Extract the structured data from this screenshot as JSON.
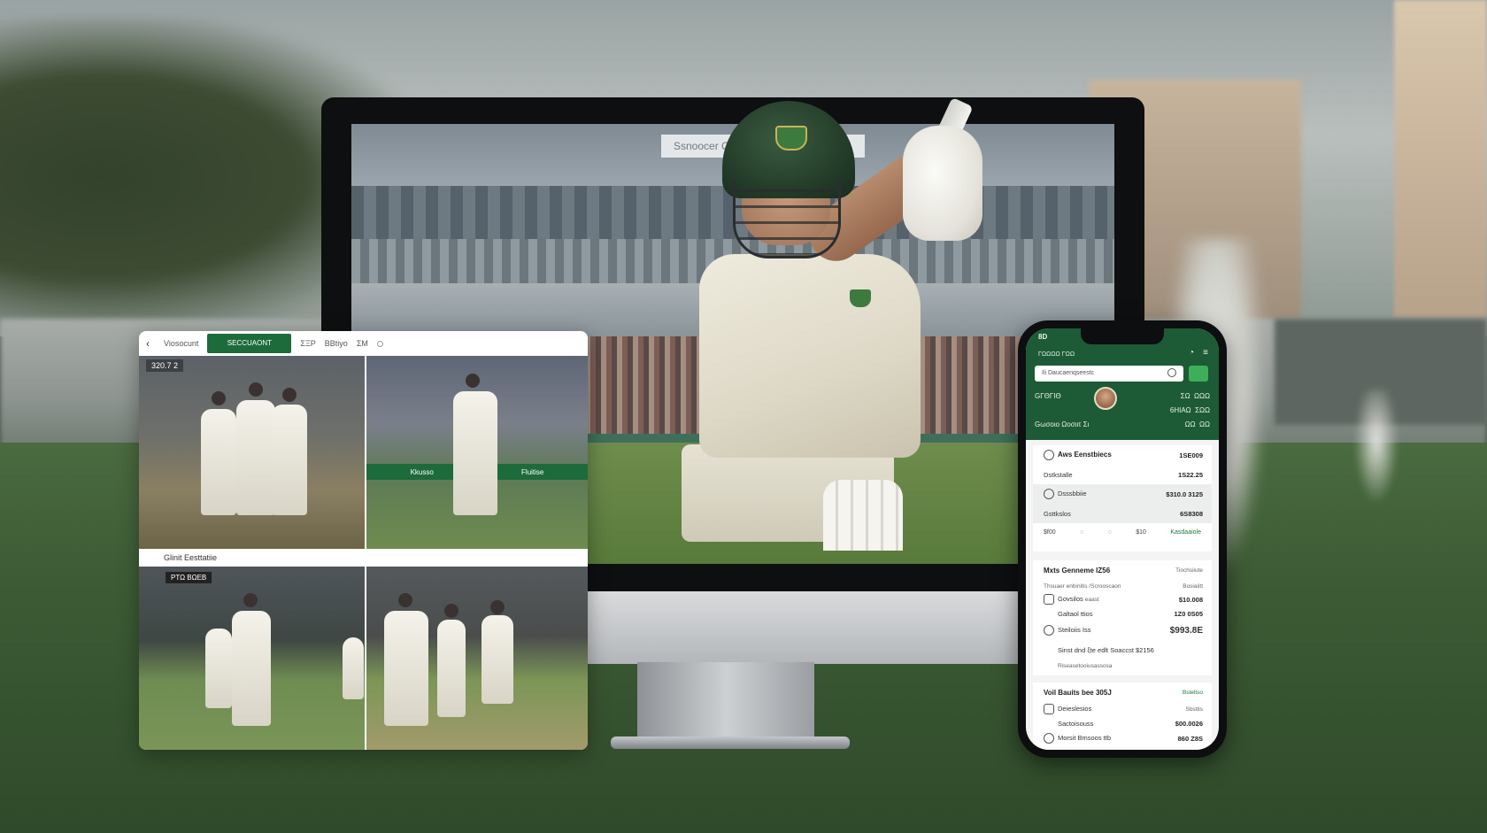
{
  "tablet": {
    "back_icon": "‹",
    "nav_label": "Viosocunt",
    "active_tab": "SECCUAONT",
    "links": [
      "ΣΞΡ",
      "BBtiyo",
      "ΣΜ"
    ],
    "tile_score": "320.7 2",
    "hoarding_left": "Kkusso",
    "hoarding_right": "Fluitise",
    "caption": "Glinit  Eesttatiie",
    "scoreboard": "ΡΤΩ ΒΩΕΒ"
  },
  "monitor": {
    "stadium_banner": "Ssnoocer Canmsty"
  },
  "phone": {
    "status_time": "8D",
    "brand": "ΓΩΩΩΩ ΓΩΩ",
    "search_placeholder": "Ili Daucaenqseestc",
    "score_rows": [
      {
        "left": "GΓΘΓΙΘ",
        "right_a": "ΣΩ",
        "right_b": "ΩΩΩ"
      },
      {
        "left": "",
        "right_a": "6ΗΙΑΩ",
        "right_b": "ΣΩΩ"
      },
      {
        "left": "Gωσοιο  Ωοσιιτ  Σι",
        "right_a": "ΩΩ",
        "right_b": "ΩΩ"
      }
    ],
    "card1": [
      {
        "label": "Aws Eenstbiecs",
        "value": "1SE009"
      },
      {
        "label": "Dstkstalle",
        "value": "1S22.25"
      },
      {
        "label": "Dsssbbiie",
        "value": "$310.0 3125"
      },
      {
        "label": "Gsttkslos",
        "value": "6S8308"
      }
    ],
    "card1_footer": [
      "$f00",
      "◌",
      "◌",
      "$10",
      "Kasdaaiole"
    ],
    "card2_title": "Mxts Genneme IZ56",
    "card2_title_right": "Tiochsiiute",
    "card2_sub": "Thsuaer enbinitis /Scrooscaon",
    "card2_sub_right": "Bosiaiitt",
    "card2_lines": [
      {
        "label": "Govsilos",
        "mid": "eaast",
        "value": "$10.008"
      },
      {
        "label": "Galtaol ttios",
        "mid": "",
        "value": "1Z0 0S05"
      },
      {
        "label": "Steiloiis Iss",
        "mid": "",
        "value": "$993.8E"
      },
      {
        "label": "Sinst dnd ξte edlt Soaccst $2156",
        "mid": "",
        "value": ""
      },
      {
        "label": "Riseasetooiusassosa",
        "mid": "",
        "value": ""
      }
    ],
    "card3_title": "Voil Bauits bee 305J",
    "card3_title_right": "Bsteltso",
    "card3_lines": [
      {
        "label": "Deieslesios",
        "value": "Sbsttis"
      },
      {
        "label": "Sactoisouss",
        "value": "$00.0026"
      },
      {
        "label": "Morsit Bmsoos ttb",
        "value": "860 Z8S"
      }
    ]
  },
  "colors": {
    "brand_green": "#1c5b35",
    "accent_green": "#3fae5a",
    "tab_green": "#1d6b3a"
  }
}
